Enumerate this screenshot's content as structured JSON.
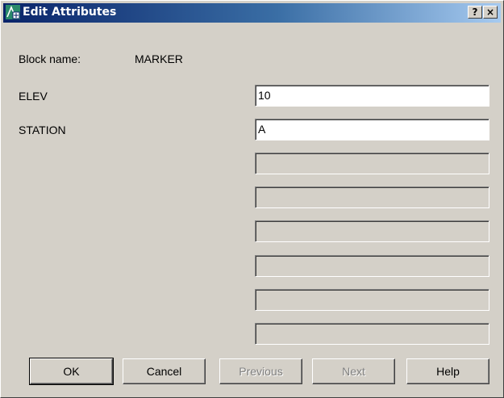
{
  "window": {
    "title": "Edit Attributes",
    "help_button": "?",
    "close_button": "×"
  },
  "block": {
    "label": "Block name:",
    "value": "MARKER"
  },
  "attributes": [
    {
      "label": "ELEV",
      "value": "10"
    },
    {
      "label": "STATION",
      "value": "A"
    },
    {
      "label": "",
      "value": ""
    },
    {
      "label": "",
      "value": ""
    },
    {
      "label": "",
      "value": ""
    },
    {
      "label": "",
      "value": ""
    },
    {
      "label": "",
      "value": ""
    },
    {
      "label": "",
      "value": ""
    }
  ],
  "buttons": {
    "ok": "OK",
    "cancel": "Cancel",
    "previous": "Previous",
    "next": "Next",
    "help": "Help"
  },
  "colors": {
    "dialog_bg": "#d4d0c8",
    "title_active": "#0a246a"
  }
}
